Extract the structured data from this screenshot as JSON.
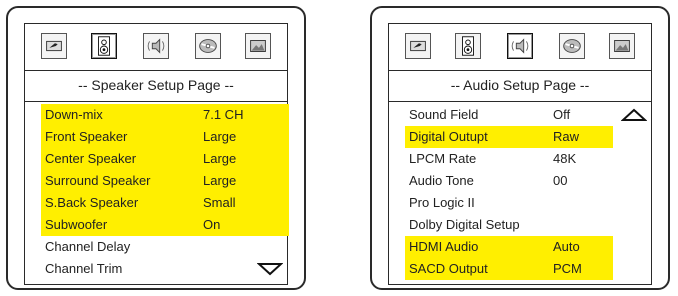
{
  "left_panel": {
    "header": "-- Speaker Setup Page --",
    "rows": [
      {
        "label": "Down-mix",
        "value": "7.1 CH"
      },
      {
        "label": "Front Speaker",
        "value": "Large"
      },
      {
        "label": "Center Speaker",
        "value": "Large"
      },
      {
        "label": "Surround Speaker",
        "value": "Large"
      },
      {
        "label": "S.Back Speaker",
        "value": "Small"
      },
      {
        "label": "Subwoofer",
        "value": "On"
      },
      {
        "label": "Channel Delay",
        "value": ""
      },
      {
        "label": "Channel Trim",
        "value": ""
      }
    ],
    "toolbar_icons": [
      "wrench-icon",
      "speaker-icon",
      "audio-icon",
      "disc-icon",
      "picture-icon"
    ],
    "active_icon": "speaker-icon",
    "scroll_indicator": "down"
  },
  "right_panel": {
    "header": "-- Audio Setup Page --",
    "rows": [
      {
        "label": "Sound Field",
        "value": "Off"
      },
      {
        "label": "Digital Outupt",
        "value": "Raw"
      },
      {
        "label": "LPCM Rate",
        "value": "48K"
      },
      {
        "label": "Audio Tone",
        "value": "00"
      },
      {
        "label": "Pro Logic II",
        "value": ""
      },
      {
        "label": "Dolby Digital Setup",
        "value": ""
      },
      {
        "label": "HDMI Audio",
        "value": "Auto"
      },
      {
        "label": "SACD Output",
        "value": "PCM"
      }
    ],
    "toolbar_icons": [
      "wrench-icon",
      "speaker-icon",
      "audio-icon",
      "disc-icon",
      "picture-icon"
    ],
    "active_icon": "audio-icon",
    "scroll_indicator": "up"
  },
  "colors": {
    "highlight": "#ffef00",
    "border": "#2a2a2a",
    "background": "#ffffff"
  }
}
